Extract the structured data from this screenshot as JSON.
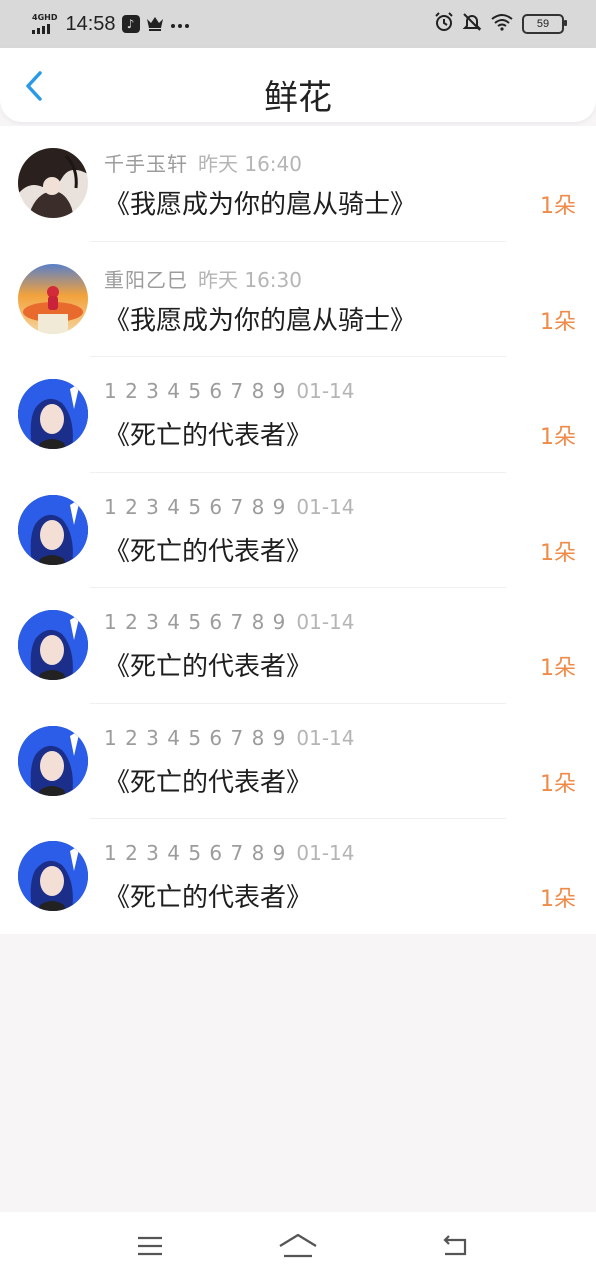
{
  "status_bar": {
    "network": "4GHD",
    "time": "14:58",
    "icons": [
      "tiktok-icon",
      "crown-icon",
      "more-dots-icon",
      "alarm-icon",
      "mute-bell-icon",
      "wifi-icon"
    ],
    "battery": "59"
  },
  "header": {
    "title": "鲜花",
    "back_icon": "chevron-left-icon"
  },
  "colors": {
    "accent": "#2a9ae8",
    "count": "#f08a47",
    "status_bar_bg": "#d9d9d9"
  },
  "items": [
    {
      "name": "千手玉轩",
      "date": "昨天 16:40",
      "book": "《我愿成为你的扈从骑士》",
      "count": "1朵",
      "avatar": "avatar-ink"
    },
    {
      "name": "重阳乙巳",
      "date": "昨天 16:30",
      "book": "《我愿成为你的扈从骑士》",
      "count": "1朵",
      "avatar": "avatar-sunset"
    },
    {
      "name": "1 2 3 4 5 6 7 8 9",
      "date": "01-14",
      "book": "《死亡的代表者》",
      "count": "1朵",
      "avatar": "avatar-blue-hair"
    },
    {
      "name": "1 2 3 4 5 6 7 8 9",
      "date": "01-14",
      "book": "《死亡的代表者》",
      "count": "1朵",
      "avatar": "avatar-blue-hair"
    },
    {
      "name": "1 2 3 4 5 6 7 8 9",
      "date": "01-14",
      "book": "《死亡的代表者》",
      "count": "1朵",
      "avatar": "avatar-blue-hair"
    },
    {
      "name": "1 2 3 4 5 6 7 8 9",
      "date": "01-14",
      "book": "《死亡的代表者》",
      "count": "1朵",
      "avatar": "avatar-blue-hair"
    },
    {
      "name": "1 2 3 4 5 6 7 8 9",
      "date": "01-14",
      "book": "《死亡的代表者》",
      "count": "1朵",
      "avatar": "avatar-blue-hair"
    }
  ],
  "nav_bar": {
    "icons": [
      "menu-icon",
      "home-icon",
      "back-arrow-icon"
    ]
  }
}
